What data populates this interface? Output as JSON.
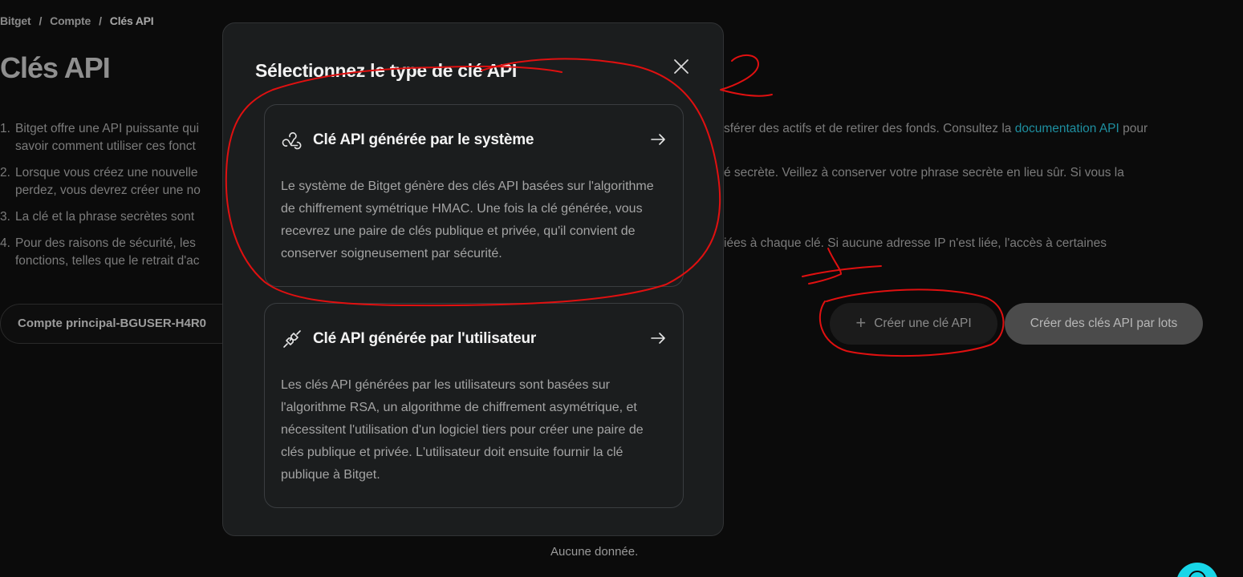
{
  "breadcrumb": {
    "items": [
      "Bitget",
      "Compte",
      "Clés API"
    ],
    "separator": "/"
  },
  "page": {
    "title": "Clés API",
    "notes": [
      {
        "num": "1.",
        "left": "Bitget offre une API puissante qui",
        "right_a": "sférer des actifs et de retirer des fonds. Consultez la ",
        "link": "documentation API",
        "right_b": " pour",
        "line2": "savoir comment utiliser ces fonct"
      },
      {
        "num": "2.",
        "left": "Lorsque vous créez une nouvelle",
        "right": "é secrète. Veillez à conserver votre phrase secrète en lieu sûr. Si vous la",
        "line2": "perdez, vous devrez créer une no"
      },
      {
        "num": "3.",
        "left": "La clé et la phrase secrètes sont"
      },
      {
        "num": "4.",
        "left": "Pour des raisons de sécurité, les",
        "right": "iées à chaque clé. Si aucune adresse IP n'est liée, l'accès à certaines",
        "line2": "fonctions, telles que le retrait d'ac"
      }
    ],
    "account_select": "Compte principal-BGUSER-H4R0",
    "create_button": "Créer une clé API",
    "batch_button": "Créer des clés API par lots",
    "empty_text": "Aucune donnée."
  },
  "modal": {
    "title": "Sélectionnez le type de clé API",
    "options": [
      {
        "icon": "webhook-icon",
        "title": "Clé API générée par le système",
        "description": "Le système de Bitget génère des clés API basées sur l'algorithme de chiffrement symétrique HMAC. Une fois la clé générée, vous recevrez une paire de clés publique et privée, qu'il convient de conserver soigneusement par sécurité."
      },
      {
        "icon": "plug-icon",
        "title": "Clé API générée par l'utilisateur",
        "description": "Les clés API générées par les utilisateurs sont basées sur l'algorithme RSA, un algorithme de chiffrement asymétrique, et nécessitent l'utilisation d'un logiciel tiers pour créer une paire de clés publique et privée. L'utilisateur doit ensuite fournir la clé publique à Bitget."
      }
    ]
  },
  "colors": {
    "background": "#0b0b0b",
    "modal_bg": "#1b1d1e",
    "link": "#1e8fa0",
    "annotation": "#e01010",
    "fab": "#18d6e8"
  }
}
